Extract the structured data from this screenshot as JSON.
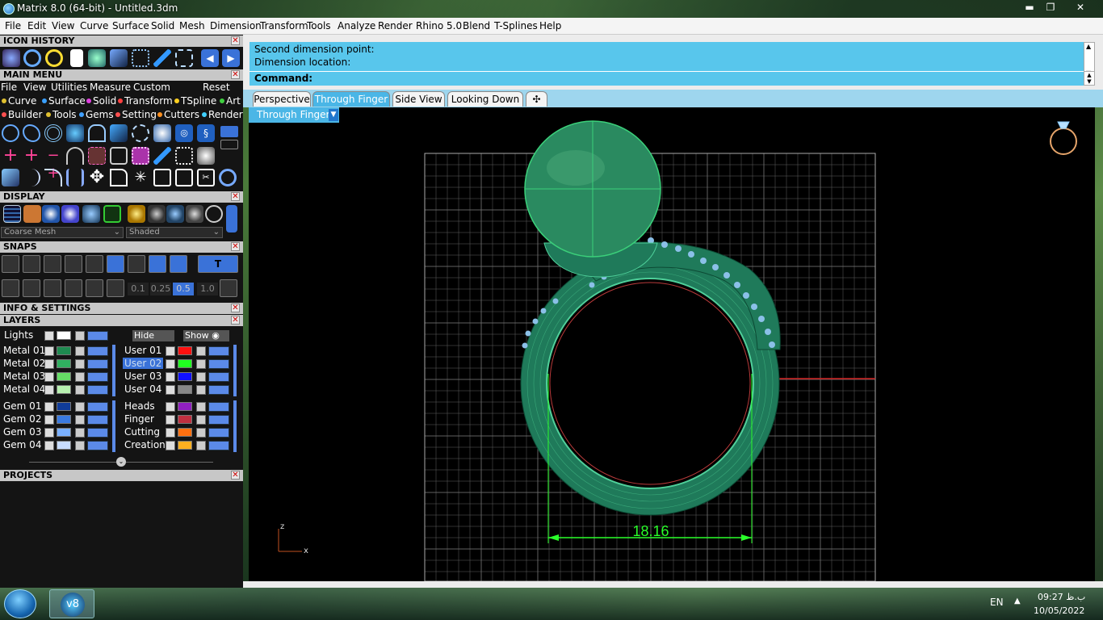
{
  "window": {
    "title": "Matrix 8.0 (64-bit) - Untitled.3dm",
    "minimize": "▬",
    "restore": "❐",
    "close": "✕"
  },
  "menubar": [
    "File",
    "Edit",
    "View",
    "Curve",
    "Surface",
    "Solid",
    "Mesh",
    "Dimension",
    "Transform",
    "Tools",
    "Analyze",
    "Render",
    "Rhino 5.0",
    "Blend",
    "T-Splines",
    "Help"
  ],
  "panels": {
    "icon_history": "ICON HISTORY",
    "main_menu": "MAIN MENU",
    "display": "DISPLAY",
    "snaps": "SNAPS",
    "info": "INFO & SETTINGS",
    "layers": "LAYERS",
    "projects": "PROJECTS",
    "close_glyph": "✕"
  },
  "main_menu": {
    "items": [
      "File",
      "View",
      "Utilities",
      "Measure",
      "Custom"
    ],
    "reset": "Reset",
    "cat_row1": [
      {
        "label": "Curve",
        "color": "#e0c030"
      },
      {
        "label": "Surface",
        "color": "#3aa0ff"
      },
      {
        "label": "Solid",
        "color": "#e040e0"
      },
      {
        "label": "Transform",
        "color": "#ff4040"
      },
      {
        "label": "TSpline",
        "color": "#ffd020"
      },
      {
        "label": "Art",
        "color": "#40d040"
      }
    ],
    "cat_row2": [
      {
        "label": "Builder",
        "color": "#ff5050"
      },
      {
        "label": "Tools",
        "color": "#e0c030"
      },
      {
        "label": "Gems",
        "color": "#40a0ff"
      },
      {
        "label": "Setting",
        "color": "#ff5050"
      },
      {
        "label": "Cutters",
        "color": "#ff9020"
      },
      {
        "label": "Render",
        "color": "#40d0ff"
      }
    ]
  },
  "display": {
    "mesh": "Coarse Mesh",
    "shading": "Shaded"
  },
  "snaps": {
    "values": [
      "0.1",
      "0.25",
      "0.5",
      "1.0"
    ]
  },
  "layers": {
    "lights": "Lights",
    "hide": "Hide",
    "show": "Show",
    "left": [
      {
        "name": "Metal 01",
        "color": "#1e8a50"
      },
      {
        "name": "Metal 02",
        "color": "#30b060"
      },
      {
        "name": "Metal 03",
        "color": "#66dd66"
      },
      {
        "name": "Metal 04",
        "color": "#b8f0b0"
      },
      {
        "name": "Gem 01",
        "color": "#103c99"
      },
      {
        "name": "Gem 02",
        "color": "#3a7ae0"
      },
      {
        "name": "Gem 03",
        "color": "#7ab0ff"
      },
      {
        "name": "Gem 04",
        "color": "#c8ddff"
      }
    ],
    "right": [
      {
        "name": "User 01",
        "color": "#ff1010"
      },
      {
        "name": "User 02",
        "color": "#20ff20"
      },
      {
        "name": "User 03",
        "color": "#1010ff"
      },
      {
        "name": "User 04",
        "color": "#888888"
      },
      {
        "name": "Heads",
        "color": "#9020c0"
      },
      {
        "name": "Finger",
        "color": "#c03040"
      },
      {
        "name": "Cutting",
        "color": "#ff7010"
      },
      {
        "name": "Creation",
        "color": "#ffb020"
      }
    ]
  },
  "command": {
    "line1": "Second dimension point:",
    "line2": "Dimension location:",
    "prompt": "Command:"
  },
  "tabs": [
    "Perspective",
    "Through Finger",
    "Side View",
    "Looking Down",
    "✣"
  ],
  "active_tab": "Through Finger",
  "viewport": {
    "label": "Through Finger",
    "dimension": "18.16",
    "axis_z": "z",
    "axis_x": "x"
  },
  "taskbar": {
    "lang": "EN",
    "time": "09:27 ب.ظ",
    "date": "10/05/2022"
  }
}
